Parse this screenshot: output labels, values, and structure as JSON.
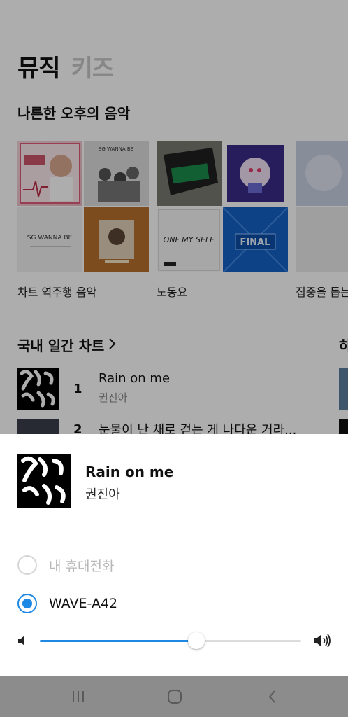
{
  "tabs": [
    {
      "label": "뮤직",
      "active": true
    },
    {
      "label": "키즈",
      "active": false
    }
  ],
  "section": {
    "title": "나른한 오후의 음악"
  },
  "playlists": [
    {
      "caption": "차트 역주행 음악"
    },
    {
      "caption": "노동요"
    },
    {
      "caption": "집중을 돕는"
    }
  ],
  "album_texts": {
    "slot1": "SG WANNA BE",
    "slot2": "FINAL",
    "slot3": "ONF MY SELF"
  },
  "chart": {
    "title": "국내 일간 차트",
    "right_title": "하",
    "rows": [
      {
        "rank": "1",
        "title": "Rain on me",
        "artist": "권진아"
      },
      {
        "rank": "2",
        "title": "눈물이 난 채로 걷는 게 나다운 거라...",
        "artist": ""
      }
    ]
  },
  "now_playing": {
    "title": "Rain on me",
    "artist": "권진아"
  },
  "devices": [
    {
      "label": "내 휴대전화",
      "selected": false
    },
    {
      "label": "WAVE-A42",
      "selected": true
    }
  ],
  "volume": {
    "level": 0.6
  },
  "colors": {
    "accent": "#1e88e5",
    "dim_overlay": "rgba(0,0,0,0.32)",
    "navbar": "#8c8c8c"
  },
  "navigation": {
    "icons": [
      "recent-apps-icon",
      "home-icon",
      "back-icon"
    ]
  }
}
